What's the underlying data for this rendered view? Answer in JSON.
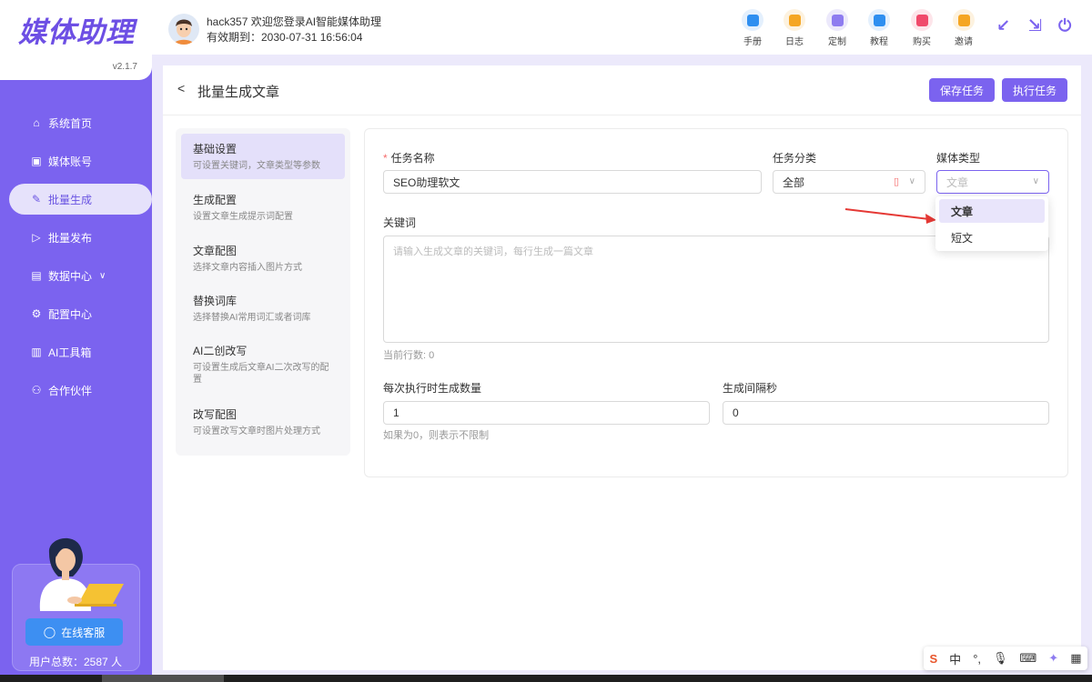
{
  "app": {
    "logo": "媒体助理",
    "version": "v2.1.7"
  },
  "sidebar": {
    "items": [
      {
        "label": "系统首页",
        "icon": "home-icon"
      },
      {
        "label": "媒体账号",
        "icon": "account-icon"
      },
      {
        "label": "批量生成",
        "icon": "edit-icon"
      },
      {
        "label": "批量发布",
        "icon": "send-icon"
      },
      {
        "label": "数据中心",
        "icon": "data-icon"
      },
      {
        "label": "配置中心",
        "icon": "gear-icon"
      },
      {
        "label": "AI工具箱",
        "icon": "book-icon"
      },
      {
        "label": "合作伙伴",
        "icon": "partner-icon"
      }
    ],
    "support_label": "在线客服",
    "users_total": "用户总数：2587 人"
  },
  "header": {
    "greeting": "hack357 欢迎您登录AI智能媒体助理",
    "expiry": "有效期到：2030-07-31 16:56:04",
    "tools": [
      {
        "label": "手册",
        "color": "#2f8ff0"
      },
      {
        "label": "日志",
        "color": "#f5a623"
      },
      {
        "label": "定制",
        "color": "#8e7cf0"
      },
      {
        "label": "教程",
        "color": "#2f8ff0"
      },
      {
        "label": "购买",
        "color": "#f04a6b"
      },
      {
        "label": "邀请",
        "color": "#f5a623"
      }
    ]
  },
  "page": {
    "title": "批量生成文章",
    "save_label": "保存任务",
    "run_label": "执行任务"
  },
  "steps": [
    {
      "title": "基础设置",
      "desc": "可设置关键词，文章类型等参数"
    },
    {
      "title": "生成配置",
      "desc": "设置文章生成提示词配置"
    },
    {
      "title": "文章配图",
      "desc": "选择文章内容插入图片方式"
    },
    {
      "title": "替换词库",
      "desc": "选择替换AI常用词汇或者词库"
    },
    {
      "title": "AI二创改写",
      "desc": "可设置生成后文章AI二次改写的配置"
    },
    {
      "title": "改写配图",
      "desc": "可设置改写文章时图片处理方式"
    }
  ],
  "form": {
    "task_name_label": "任务名称",
    "task_name_value": "SEO助理软文",
    "category_label": "任务分类",
    "category_value": "全部",
    "media_type_label": "媒体类型",
    "media_type_placeholder": "文章",
    "keywords_label": "关键词",
    "keywords_placeholder": "请输入生成文章的关键词，每行生成一篇文章",
    "line_count": "当前行数: 0",
    "count_label": "每次执行时生成数量",
    "count_value": "1",
    "count_hint": "如果为0，则表示不限制",
    "interval_label": "生成间隔秒",
    "interval_value": "0"
  },
  "dropdown": {
    "options": [
      "文章",
      "短文"
    ]
  },
  "ime": [
    "S",
    "中",
    "°,",
    "🎙",
    "⌨",
    "✦",
    "▦"
  ]
}
